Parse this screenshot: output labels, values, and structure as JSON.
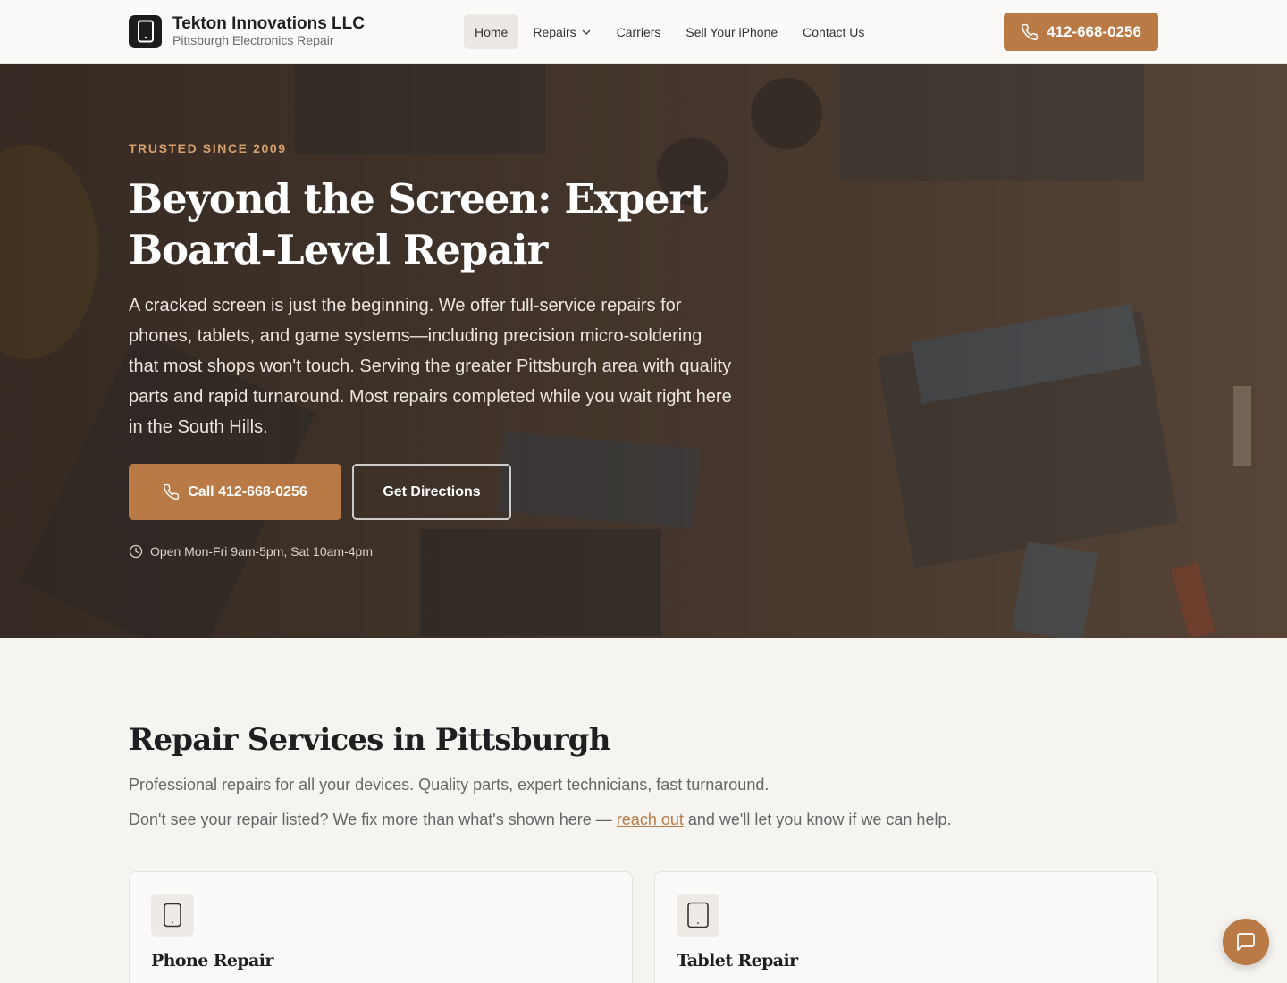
{
  "brand": {
    "name": "Tekton Innovations LLC",
    "tagline": "Pittsburgh Electronics Repair",
    "logo_icon": "smartphone-icon"
  },
  "nav": {
    "items": [
      {
        "label": "Home",
        "active": true
      },
      {
        "label": "Repairs",
        "has_dropdown": true
      },
      {
        "label": "Carriers"
      },
      {
        "label": "Sell Your iPhone"
      },
      {
        "label": "Contact Us"
      }
    ],
    "phone_label": "412-668-0256",
    "phone_icon": "phone-icon"
  },
  "hero": {
    "eyebrow": "TRUSTED SINCE 2009",
    "title": "Beyond the Screen: Expert Board-Level Repair",
    "description": "A cracked screen is just the beginning. We offer full-service repairs for phones, tablets, and game systems—including precision micro-soldering that most shops won't touch. Serving the greater Pittsburgh area with quality parts and rapid turnaround. Most repairs completed while you wait right here in the South Hills.",
    "call_button": "Call 412-668-0256",
    "directions_button": "Get Directions",
    "hours": "Open Mon-Fri 9am-5pm, Sat 10am-4pm",
    "hours_icon": "clock-icon"
  },
  "services": {
    "title": "Repair Services in Pittsburgh",
    "subtitle": "Professional repairs for all your devices. Quality parts, expert technicians, fast turnaround.",
    "note_before": "Don't see your repair listed? We fix more than what's shown here — ",
    "note_link": "reach out",
    "note_after": " and we'll let you know if we can help.",
    "cards": [
      {
        "title": "Phone Repair",
        "icon": "phone-device-icon"
      },
      {
        "title": "Tablet Repair",
        "icon": "tablet-device-icon"
      }
    ]
  },
  "chat": {
    "icon": "chat-icon"
  },
  "colors": {
    "accent": "#b97a45",
    "eyebrow": "#d8a06c",
    "page_bg": "#f6f4f0",
    "dark": "#1f1f1f"
  }
}
